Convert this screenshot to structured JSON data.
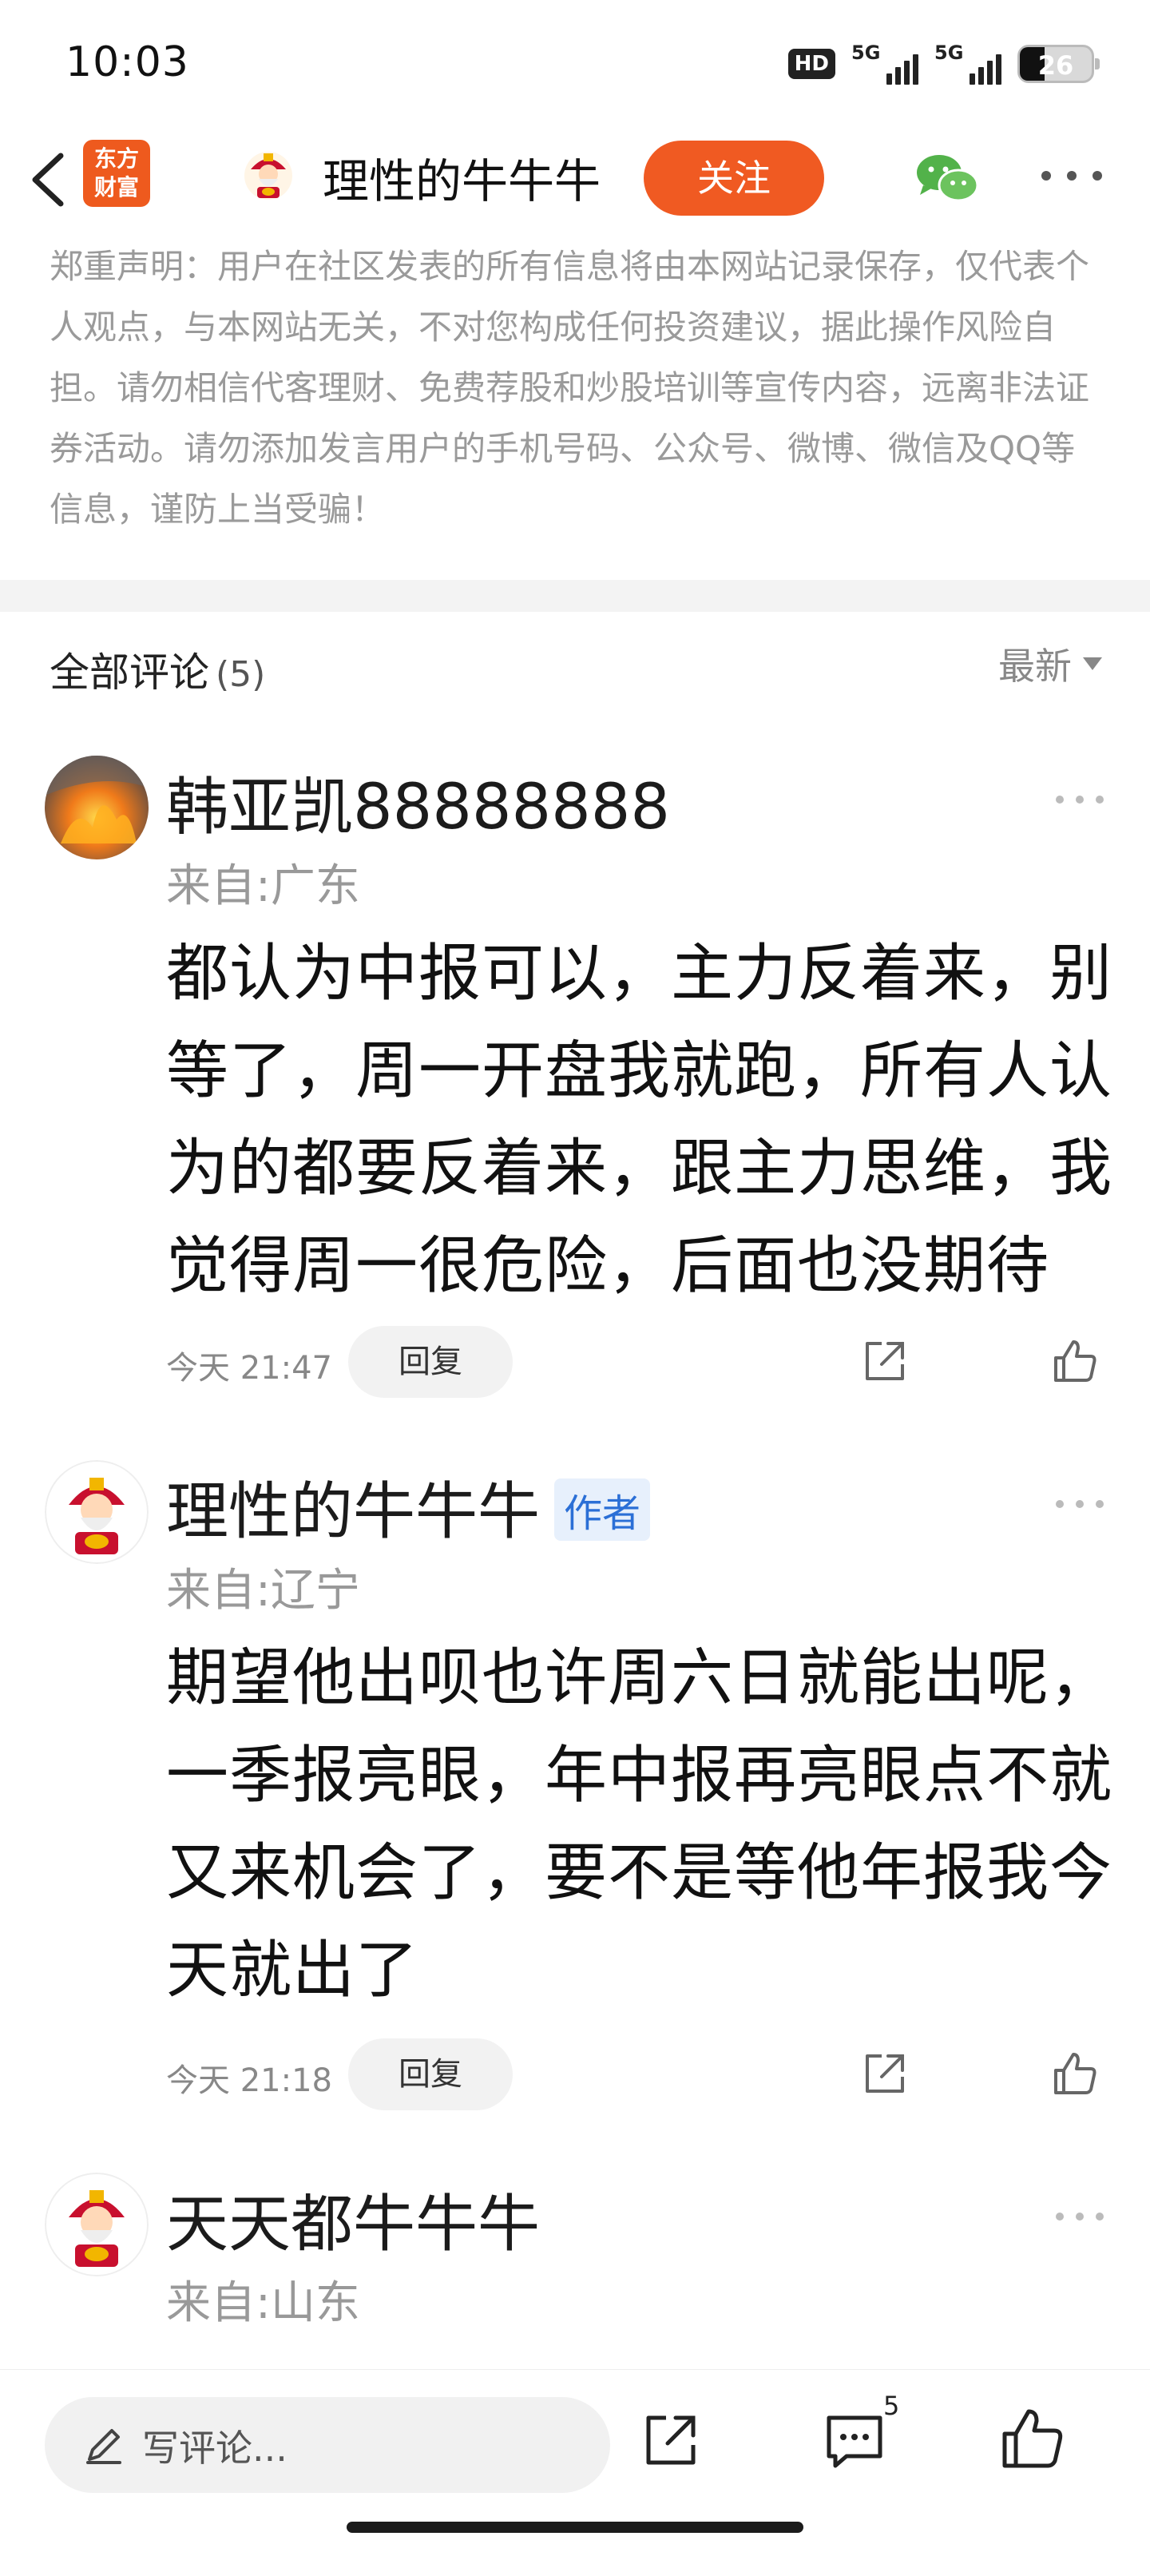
{
  "status_bar": {
    "time": "10:03",
    "hd_label": "HD",
    "network_1": "5G",
    "network_2": "5G",
    "battery": "26"
  },
  "header": {
    "back_icon": "chevron-left-icon",
    "logo_line1": "东方",
    "logo_line2": "财富",
    "title": "理性的牛牛牛",
    "follow_label": "关注",
    "wechat_icon": "wechat-icon",
    "more_icon": "more-icon",
    "accent_color": "#f05a22"
  },
  "disclaimer": "郑重声明：用户在社区发表的所有信息将由本网站记录保存，仅代表个人观点，与本网站无关，不对您构成任何投资建议，据此操作风险自担。请勿相信代客理财、免费荐股和炒股培训等宣传内容，远离非法证券活动。请勿添加发言用户的手机号码、公众号、微博、微信及QQ等信息，谨防上当受骗！",
  "comments_section": {
    "title": "全部评论",
    "count": "(5)",
    "sort_label": "最新"
  },
  "comments": [
    {
      "name": "韩亚凯88888888",
      "location": "来自:广东",
      "body": "都认为中报可以，主力反着来，别等了，周一开盘我就跑，所有人认为的都要反着来，跟主力思维，我觉得周一很危险，后面也没期待",
      "time": "今天 21:47",
      "reply_label": "回复"
    },
    {
      "name": "理性的牛牛牛",
      "author_tag": "作者",
      "location": "来自:辽宁",
      "body": "期望他出呗也许周六日就能出呢，一季报亮眼，年中报再亮眼点不就又来机会了，要不是等他年报我今天就出了",
      "time": "今天 21:18",
      "reply_label": "回复"
    },
    {
      "name": "天天都牛牛牛",
      "location": "来自:山东",
      "body": ""
    }
  ],
  "bottom_bar": {
    "write_placeholder": "写评论...",
    "comment_count": "5"
  }
}
